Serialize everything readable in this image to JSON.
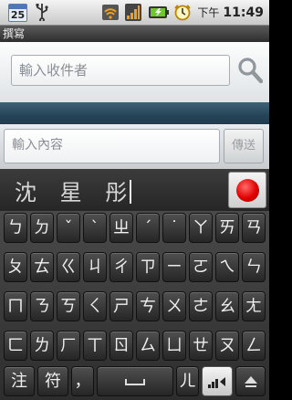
{
  "status_bar": {
    "calendar_day": "25",
    "ampm": "下午",
    "time": "11:49",
    "icons": [
      "calendar-icon",
      "usb-icon",
      "wifi-icon",
      "signal-icon",
      "battery-icon",
      "alarm-icon"
    ]
  },
  "title": "撰寫",
  "recipient": {
    "placeholder": "輸入收件者"
  },
  "message": {
    "placeholder": "輸入內容",
    "send_label": "傳送"
  },
  "candidates": {
    "text": "沈 星 彤"
  },
  "keyboard": {
    "rows": [
      [
        "ㄅ",
        "ㄉ",
        "ˇ",
        "ˋ",
        "ㄓ",
        "ˊ",
        "˙",
        "ㄚ",
        "ㄞ",
        "ㄢ"
      ],
      [
        "ㄆ",
        "ㄊ",
        "ㄍ",
        "ㄐ",
        "ㄔ",
        "ㄗ",
        "ㄧ",
        "ㄛ",
        "ㄟ",
        "ㄣ"
      ],
      [
        "ㄇ",
        "ㄋ",
        "ㄎ",
        "ㄑ",
        "ㄕ",
        "ㄘ",
        "ㄨ",
        "ㄜ",
        "ㄠ",
        "ㄤ"
      ],
      [
        "ㄈ",
        "ㄌ",
        "ㄏ",
        "ㄒ",
        "ㄖ",
        "ㄙ",
        "ㄩ",
        "ㄝ",
        "ㄡ",
        "ㄥ"
      ]
    ],
    "bottom": {
      "zhuyin": "注",
      "symbols": "符",
      "comma": "，",
      "er": "ㄦ"
    }
  }
}
